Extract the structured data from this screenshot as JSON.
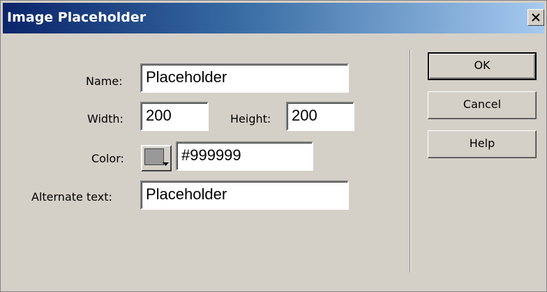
{
  "window": {
    "title": "Image Placeholder",
    "close_symbol": "×"
  },
  "form": {
    "name_label": "Name:",
    "name_value": "Placeholder",
    "width_label": "Width:",
    "width_value": "200",
    "height_label": "Height:",
    "height_value": "200",
    "color_label": "Color:",
    "color_value": "#999999",
    "alt_label": "Alternate text:",
    "alt_value": "Placeholder"
  },
  "buttons": {
    "ok": "OK",
    "cancel": "Cancel",
    "help": "Help"
  },
  "icons": {
    "close": "close-icon",
    "swatch_arrow": "dropdown-arrow-icon"
  },
  "colors": {
    "title_gradient_start": "#0a246a",
    "title_gradient_end": "#a6caf0",
    "dialog_bg": "#d4d0c8",
    "swatch": "#999999"
  }
}
